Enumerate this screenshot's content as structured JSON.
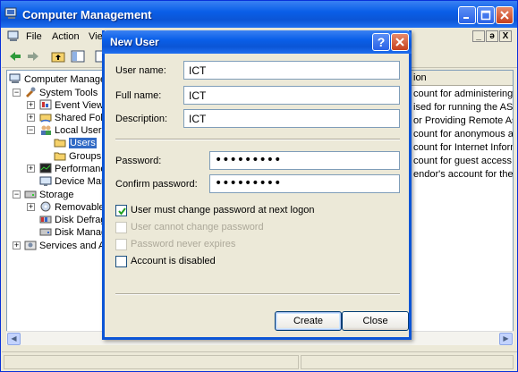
{
  "main_window": {
    "title": "Computer Management",
    "menu": [
      "File",
      "Action",
      "View"
    ],
    "mdi_controls": [
      "_",
      "ə",
      "X"
    ]
  },
  "tree": {
    "items": [
      {
        "label": "Computer Manageme"
      },
      {
        "label": "System Tools"
      },
      {
        "label": "Event Viewer"
      },
      {
        "label": "Shared Folde"
      },
      {
        "label": "Local Users a"
      },
      {
        "label": "Users"
      },
      {
        "label": "Groups"
      },
      {
        "label": "Performance"
      },
      {
        "label": "Device Mana"
      },
      {
        "label": "Storage"
      },
      {
        "label": "Removable S"
      },
      {
        "label": "Disk Defragn"
      },
      {
        "label": "Disk Manage"
      },
      {
        "label": "Services and App"
      }
    ]
  },
  "list": {
    "header": "ion",
    "rows": [
      "count for administering the",
      "ised for running the ASP.I",
      "or Providing Remote Assis",
      "count for anonymous acc",
      "count for Internet Inform",
      "count for guest access to",
      "endor's account for the H"
    ]
  },
  "dialog": {
    "title": "New User",
    "help": "?",
    "fields": {
      "username_label": "User name:",
      "username_value": "ICT",
      "fullname_label": "Full name:",
      "fullname_value": "ICT",
      "description_label": "Description:",
      "description_value": "ICT",
      "password_label": "Password:",
      "password_value": "•••••••••",
      "confirm_label": "Confirm password:",
      "confirm_value": "•••••••••"
    },
    "options": [
      {
        "label": "User must change password at next logon",
        "checked": true,
        "enabled": true
      },
      {
        "label": "User cannot change password",
        "checked": false,
        "enabled": false
      },
      {
        "label": "Password never expires",
        "checked": false,
        "enabled": false
      },
      {
        "label": "Account is disabled",
        "checked": false,
        "enabled": true
      }
    ],
    "buttons": {
      "create": "Create",
      "close": "Close"
    }
  }
}
